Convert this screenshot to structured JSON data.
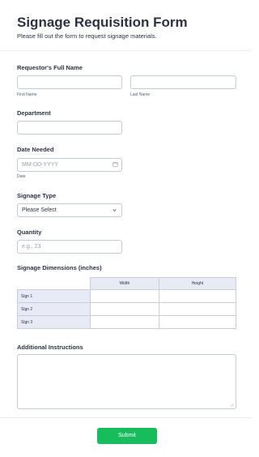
{
  "form": {
    "title": "Signage Requisition Form",
    "subtitle": "Please fill out the form to request signage materials."
  },
  "fields": {
    "full_name": {
      "label": "Requestor's Full Name",
      "first_sublabel": "First Name",
      "last_sublabel": "Last Name",
      "first_value": "",
      "last_value": ""
    },
    "department": {
      "label": "Department",
      "value": ""
    },
    "date_needed": {
      "label": "Date Needed",
      "placeholder": "MM-DD-YYYY",
      "sublabel": "Date",
      "icon": "calendar-icon"
    },
    "signage_type": {
      "label": "Signage Type",
      "selected": "Please Select",
      "icon": "chevron-down-icon"
    },
    "quantity": {
      "label": "Quantity",
      "placeholder": "e.g., 23"
    },
    "dimensions": {
      "label": "Signage Dimensions (inches)",
      "columns": [
        "Width",
        "Height"
      ],
      "rows": [
        "Sign 1",
        "Sign 2",
        "Sign 3"
      ]
    },
    "instructions": {
      "label": "Additional Instructions",
      "value": ""
    }
  },
  "actions": {
    "submit_label": "Submit"
  },
  "colors": {
    "accent": "#18bd5b",
    "border": "#c3cad8",
    "table_header": "#e8ebf6",
    "text": "#2c3345"
  }
}
